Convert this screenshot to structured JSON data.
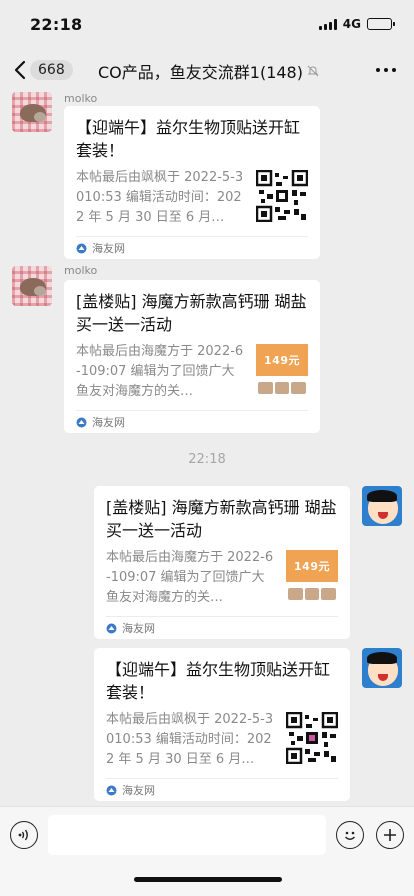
{
  "status_bar": {
    "time": "22:18",
    "network": "4G"
  },
  "nav": {
    "unread_count": "668",
    "title": "CO产品，鱼友交流群1(148)"
  },
  "messages": [
    {
      "sender": "molko",
      "title": "【迎端午】益尔生物顶贴送开缸套装！",
      "description": "本帖最后由飒枫于 2022-5-3010:53 编辑活动时间：2022 年 5 月 30 日至 6 月…",
      "thumbnail": "qr-code",
      "source": "海友网"
    },
    {
      "sender": "molko",
      "title": "[盖楼贴] 海魔方新款高钙珊 瑚盐买一送一活动",
      "description": "本帖最后由海魔方于 2022-6-109:07 编辑为了回馈广大鱼友对海魔方的关…",
      "thumbnail": "promo",
      "thumb_text": "149元",
      "source": "海友网"
    },
    {
      "sender": "",
      "title": "[盖楼贴] 海魔方新款高钙珊 瑚盐买一送一活动",
      "description": "本帖最后由海魔方于 2022-6-109:07 编辑为了回馈广大鱼友对海魔方的关…",
      "thumbnail": "promo",
      "thumb_text": "149元",
      "source": "海友网"
    },
    {
      "sender": "",
      "title": "【迎端午】益尔生物顶贴送开缸套装！",
      "description": "本帖最后由飒枫于 2022-5-3010:53 编辑活动时间：2022 年 5 月 30 日至 6 月…",
      "thumbnail": "qr-code",
      "source": "海友网"
    }
  ],
  "time_divider": "22:18",
  "colors": {
    "background": "#ededed",
    "card": "#ffffff",
    "promo_orange": "#f0a353"
  },
  "icons": [
    "back-icon",
    "mute-icon",
    "more-icon",
    "source-logo-icon",
    "voice-icon",
    "emoji-icon",
    "plus-icon"
  ]
}
